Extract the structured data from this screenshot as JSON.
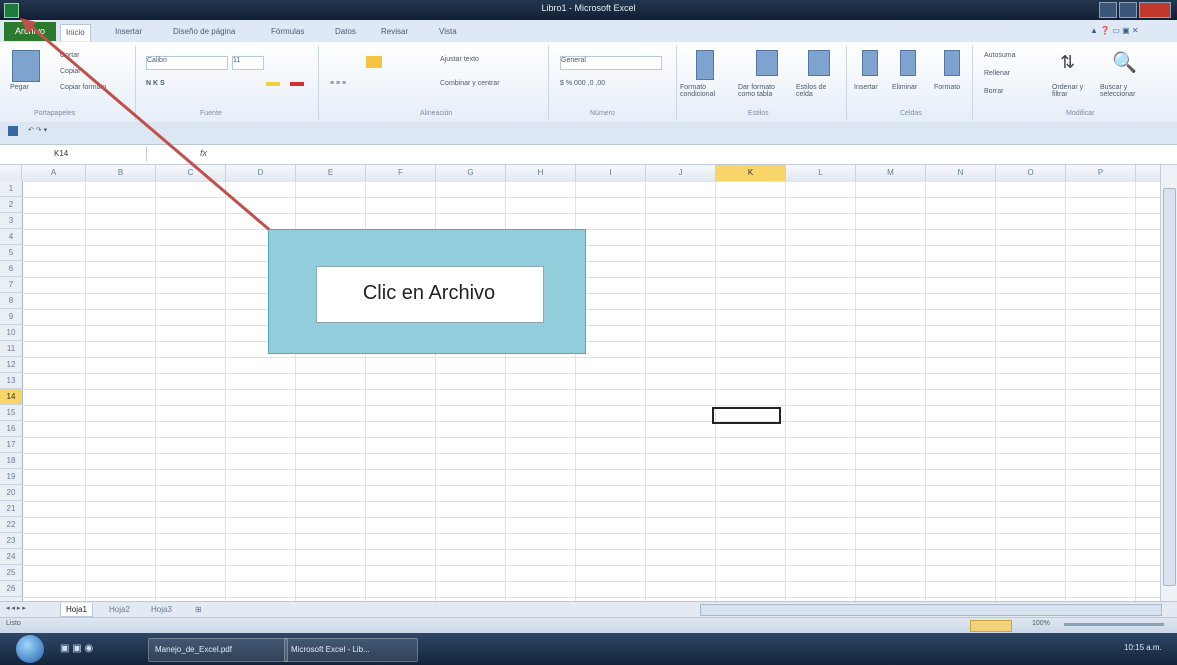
{
  "window": {
    "title": "Libro1 - Microsoft Excel"
  },
  "ribbon_tabs": [
    {
      "label": "Archivo"
    },
    {
      "label": "Inicio"
    },
    {
      "label": "Insertar"
    },
    {
      "label": "Diseño de página"
    },
    {
      "label": "Fórmulas"
    },
    {
      "label": "Datos"
    },
    {
      "label": "Revisar"
    },
    {
      "label": "Vista"
    }
  ],
  "ribbon": {
    "clipboard": {
      "paste": "Pegar",
      "cut": "Cortar",
      "copy": "Copiar",
      "format_painter": "Copiar formato",
      "group": "Portapapeles"
    },
    "font": {
      "name": "Calibri",
      "size": "11",
      "group": "Fuente"
    },
    "alignment": {
      "wrap": "Ajustar texto",
      "merge": "Combinar y centrar",
      "group": "Alineación"
    },
    "number": {
      "format": "General",
      "group": "Número"
    },
    "styles": {
      "conditional": "Formato condicional",
      "table": "Dar formato como tabla",
      "cell_styles": "Estilos de celda",
      "group": "Estilos"
    },
    "cells": {
      "insert": "Insertar",
      "delete": "Eliminar",
      "format": "Formato",
      "group": "Celdas"
    },
    "editing": {
      "autosum": "Autosuma",
      "fill": "Rellenar",
      "clear": "Borrar",
      "sort": "Ordenar y filtrar",
      "find": "Buscar y seleccionar",
      "group": "Modificar"
    }
  },
  "formula_bar": {
    "name_box": "K14",
    "fx": "fx",
    "value": ""
  },
  "columns": [
    "A",
    "B",
    "C",
    "D",
    "E",
    "F",
    "G",
    "H",
    "I",
    "J",
    "K",
    "L",
    "M",
    "N",
    "O",
    "P"
  ],
  "selected_column": "K",
  "rows": [
    "1",
    "2",
    "3",
    "4",
    "5",
    "6",
    "7",
    "8",
    "9",
    "10",
    "11",
    "12",
    "13",
    "14",
    "15",
    "16",
    "17",
    "18",
    "19",
    "20",
    "21",
    "22",
    "23",
    "24",
    "25",
    "26"
  ],
  "selected_row": "14",
  "sheets": [
    {
      "label": "Hoja1"
    },
    {
      "label": "Hoja2"
    },
    {
      "label": "Hoja3"
    }
  ],
  "status": {
    "text": "Listo",
    "zoom": "100%"
  },
  "callout": {
    "text": "Clic en Archivo",
    "fill": "#92cddc",
    "arrow_color": "#c0504d"
  },
  "taskbar": {
    "items": [
      {
        "label": "Manejo_de_Excel.pdf"
      },
      {
        "label": "Microsoft Excel - Lib..."
      }
    ],
    "clock": "10:15 a.m."
  },
  "colors": {
    "file_tab": "#2b7a2e",
    "selection": "#f8d568"
  }
}
